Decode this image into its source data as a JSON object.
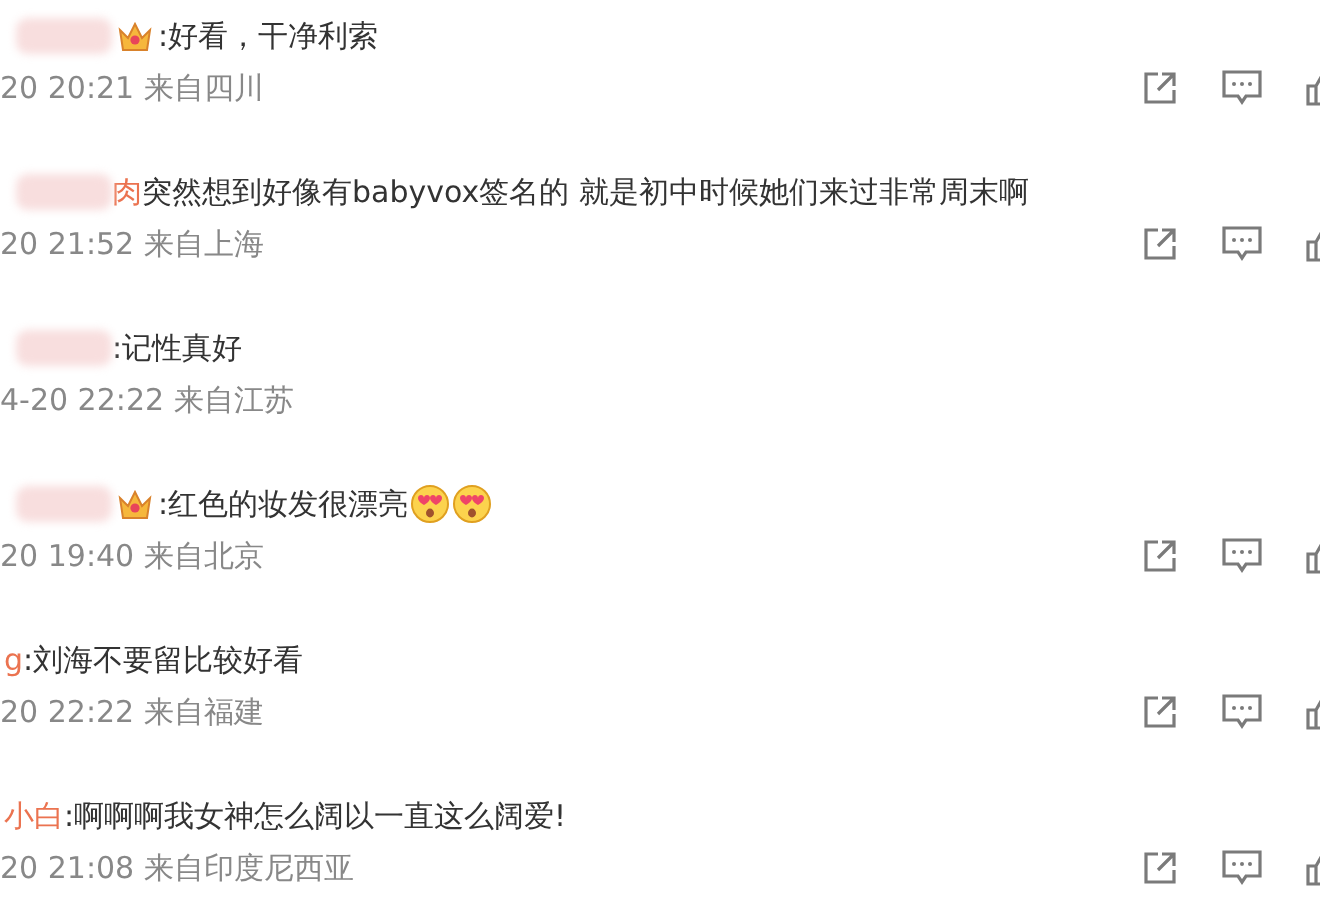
{
  "comments": [
    {
      "redacted": true,
      "crown": true,
      "text": ":好看，干净利索",
      "time": "20 20:21",
      "location": "来自四川",
      "actions": true
    },
    {
      "name": "肉",
      "redacted": true,
      "crown": false,
      "text": " 突然想到好像有babyvox签名的 就是初中时候她们来过非常周末啊",
      "time": "20 21:52",
      "location": "来自上海",
      "actions": true
    },
    {
      "redacted": true,
      "crown": false,
      "text": ":记性真好",
      "time": "4-20 22:22",
      "location": "来自江苏",
      "actions": false
    },
    {
      "redacted": true,
      "crown": true,
      "text": ":红色的妆发很漂亮",
      "emojis": [
        {
          "kind": "heart-eyes"
        },
        {
          "kind": "heart-eyes"
        }
      ],
      "time": "20 19:40",
      "location": "来自北京",
      "actions": true
    },
    {
      "name": "g",
      "redacted": false,
      "crown": false,
      "text": ":刘海不要留比较好看",
      "time": "20 22:22",
      "location": "来自福建",
      "actions": true
    },
    {
      "name": "小白",
      "redacted": false,
      "crown": false,
      "text": ":啊啊啊我女神怎么阔以一直这么阔爱!",
      "time": "20 21:08",
      "location": "来自印度尼西亚",
      "actions": true
    }
  ]
}
